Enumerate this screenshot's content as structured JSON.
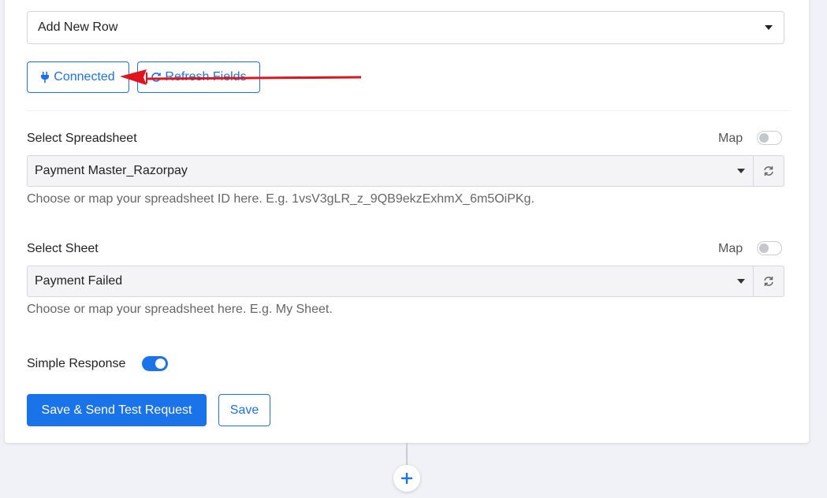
{
  "action_event": {
    "selected": "Add New Row"
  },
  "buttons": {
    "connected_label": "Connected",
    "refresh_fields_label": "Refresh Fields"
  },
  "spreadsheet": {
    "label": "Select Spreadsheet",
    "map_label": "Map",
    "value": "Payment Master_Razorpay",
    "help": "Choose or map your spreadsheet ID here. E.g. 1vsV3gLR_z_9QB9ekzExhmX_6m5OiPKg."
  },
  "sheet": {
    "label": "Select Sheet",
    "map_label": "Map",
    "value": "Payment Failed",
    "help": "Choose or map your spreadsheet here. E.g. My Sheet."
  },
  "simple_response": {
    "label": "Simple Response",
    "enabled": true
  },
  "footer": {
    "save_send_label": "Save & Send Test Request",
    "save_label": "Save"
  },
  "colors": {
    "accent": "#1a73e8",
    "annotation_arrow": "#e0141e"
  },
  "icons": {
    "connected": "plug-icon",
    "refresh_fields": "refresh-icon",
    "dropdown": "caret-down-icon",
    "reload": "sync-icon",
    "add_step": "plus-icon"
  }
}
